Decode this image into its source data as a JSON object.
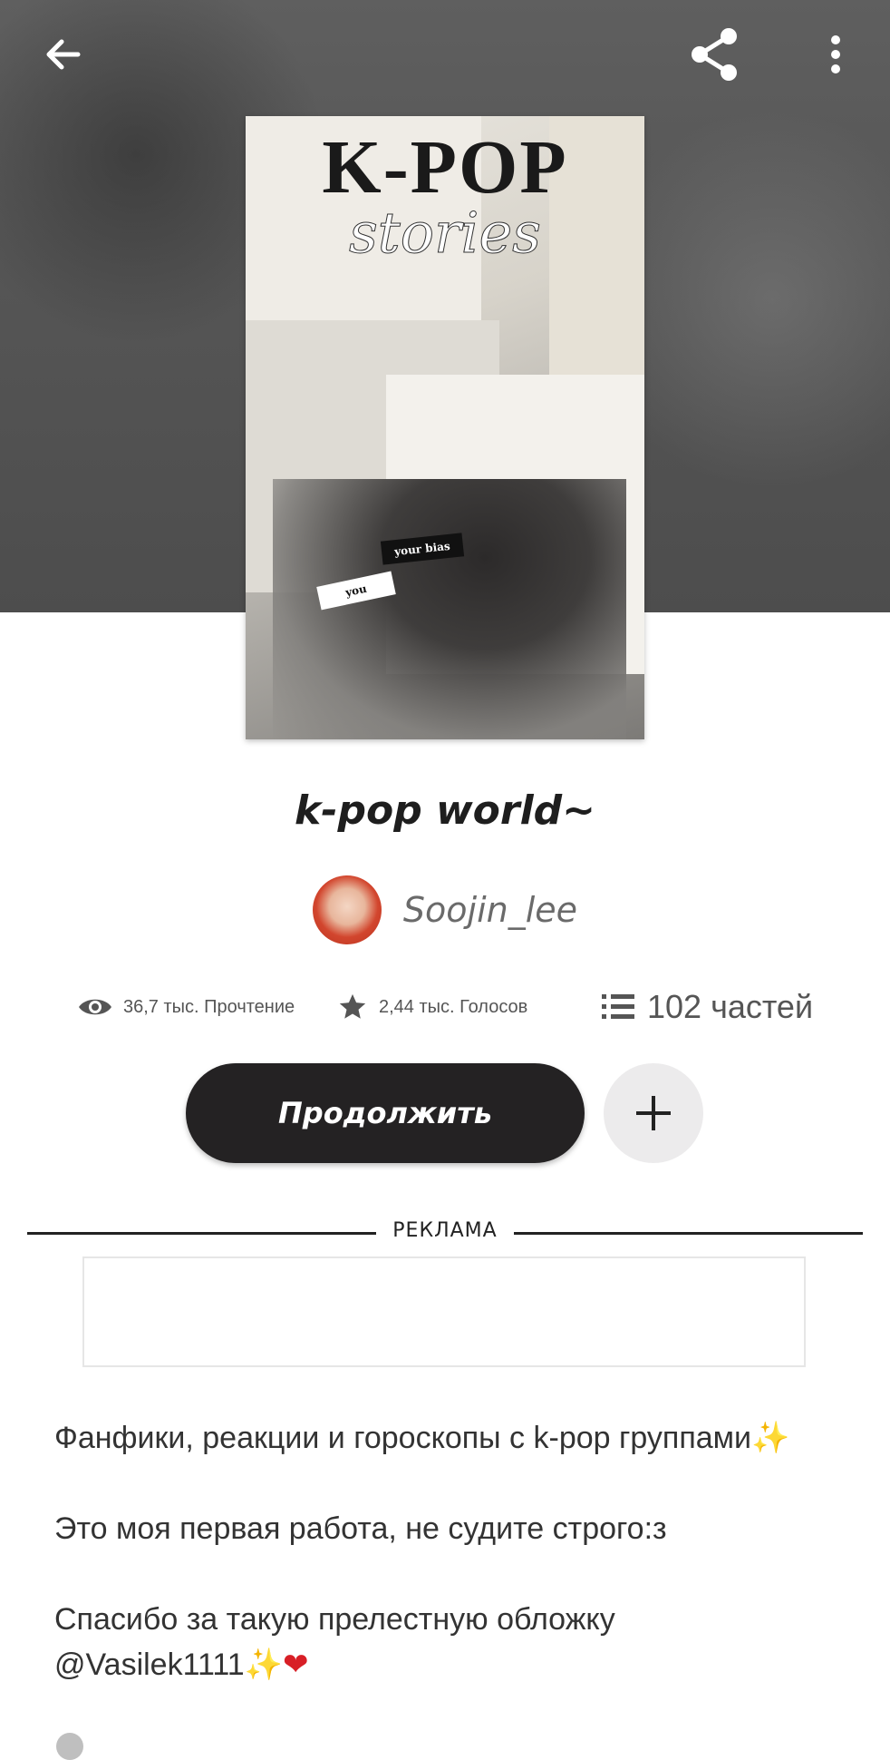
{
  "cover": {
    "title_text": "K-POP",
    "subtitle_text": "stories",
    "tag_your_bias": "your bias",
    "tag_you": "you"
  },
  "story": {
    "title": "k-pop world~",
    "author": "Soojin_lee"
  },
  "stats": {
    "reads": "36,7 тыс. Прочтение",
    "votes": "2,44 тыс. Голосов",
    "parts": "102 частей"
  },
  "actions": {
    "continue_label": "Продолжить"
  },
  "ad": {
    "label": "РЕКЛАМА"
  },
  "description": {
    "line1": "Фанфики, реакции и гороскопы с k-pop группами",
    "line2": "Это моя первая работа, не судите строго:з",
    "line3a": "Спасибо за такую прелестную обложку",
    "line3b": "@Vasilek1111"
  },
  "icons": {
    "back": "arrow-left-icon",
    "share": "share-icon",
    "more": "more-vertical-icon",
    "reads": "eye-icon",
    "votes": "star-icon",
    "parts": "list-icon",
    "add": "plus-icon"
  },
  "colors": {
    "button_dark": "#242223",
    "add_button_bg": "#ecebec",
    "hero_bg": "#565656"
  }
}
